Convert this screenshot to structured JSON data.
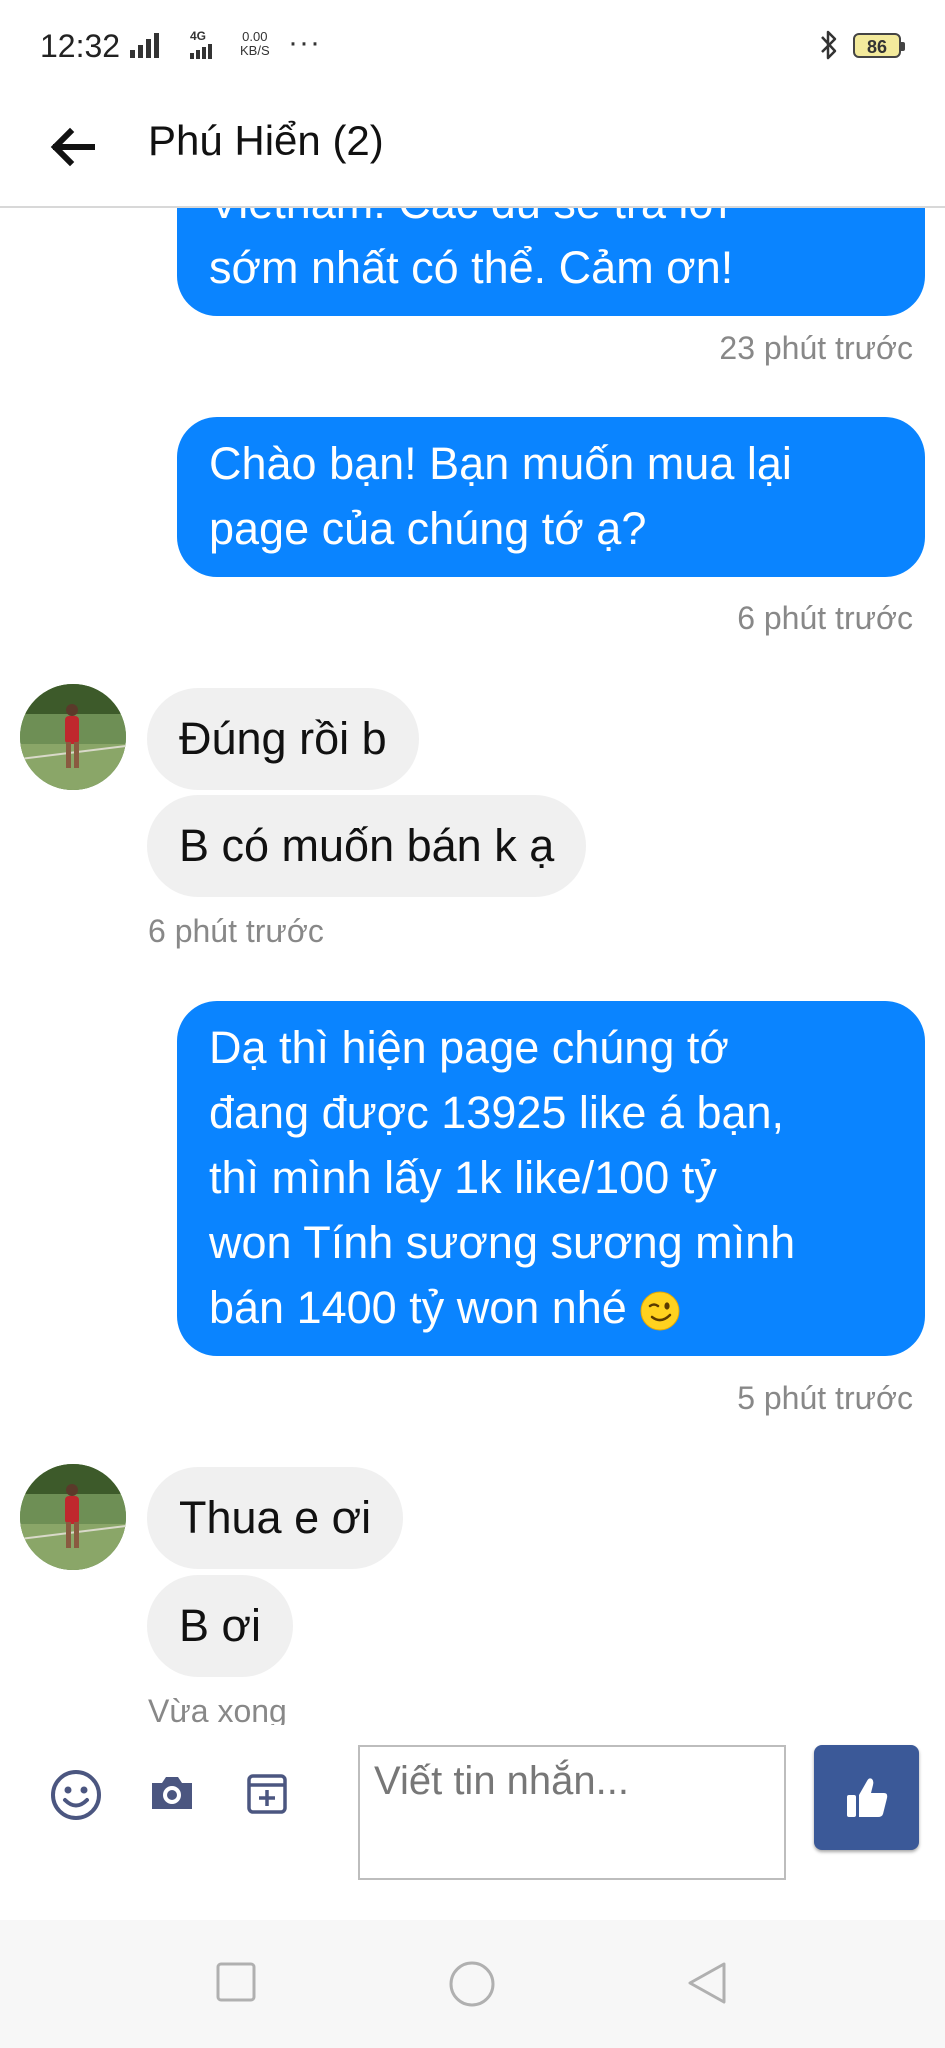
{
  "status_bar": {
    "time": "12:32",
    "network": "4G",
    "speed_value": "0.00",
    "speed_unit": "KB/S",
    "more": "···",
    "battery": "86"
  },
  "header": {
    "title": "Phú Hiển (2)",
    "back_icon": "arrow-left-icon"
  },
  "messages": [
    {
      "side": "out",
      "lines": [
        "Vietnam. Các đủ sẽ trả lời",
        "sớm nhất có thể. Cảm ơn!"
      ],
      "time": "23 phút trước"
    },
    {
      "side": "out",
      "lines": [
        "Chào bạn! Bạn muốn mua lại",
        "page của chúng tớ ạ?"
      ],
      "time": "6 phút trước"
    },
    {
      "side": "in",
      "text": "Đúng rồi b"
    },
    {
      "side": "in",
      "text": "B có muốn bán k ạ",
      "time": "6 phút trước"
    },
    {
      "side": "out",
      "lines": [
        "Dạ thì hiện page chúng tớ",
        "đang được 13925 like á bạn,",
        "thì mình lấy 1k like/100 tỷ",
        "won Tính sương sương mình",
        "bán 1400 tỷ won nhé"
      ],
      "emoji": "wink-emoji",
      "time": "5 phút trước"
    },
    {
      "side": "in",
      "text": "Thua e ơi"
    },
    {
      "side": "in",
      "text": "B ơi",
      "time": "Vừa xong"
    }
  ],
  "composer": {
    "placeholder": "Viết tin nhắn...",
    "icons": [
      "emoji-icon",
      "camera-icon",
      "sticker-icon",
      "like-icon"
    ]
  },
  "navbar": {
    "icons": [
      "recent-apps-icon",
      "home-icon",
      "back-triangle-icon"
    ]
  },
  "colors": {
    "outgoing_bubble": "#0a84ff",
    "incoming_bubble": "#f0f0f0",
    "like_button": "#3b5998"
  }
}
